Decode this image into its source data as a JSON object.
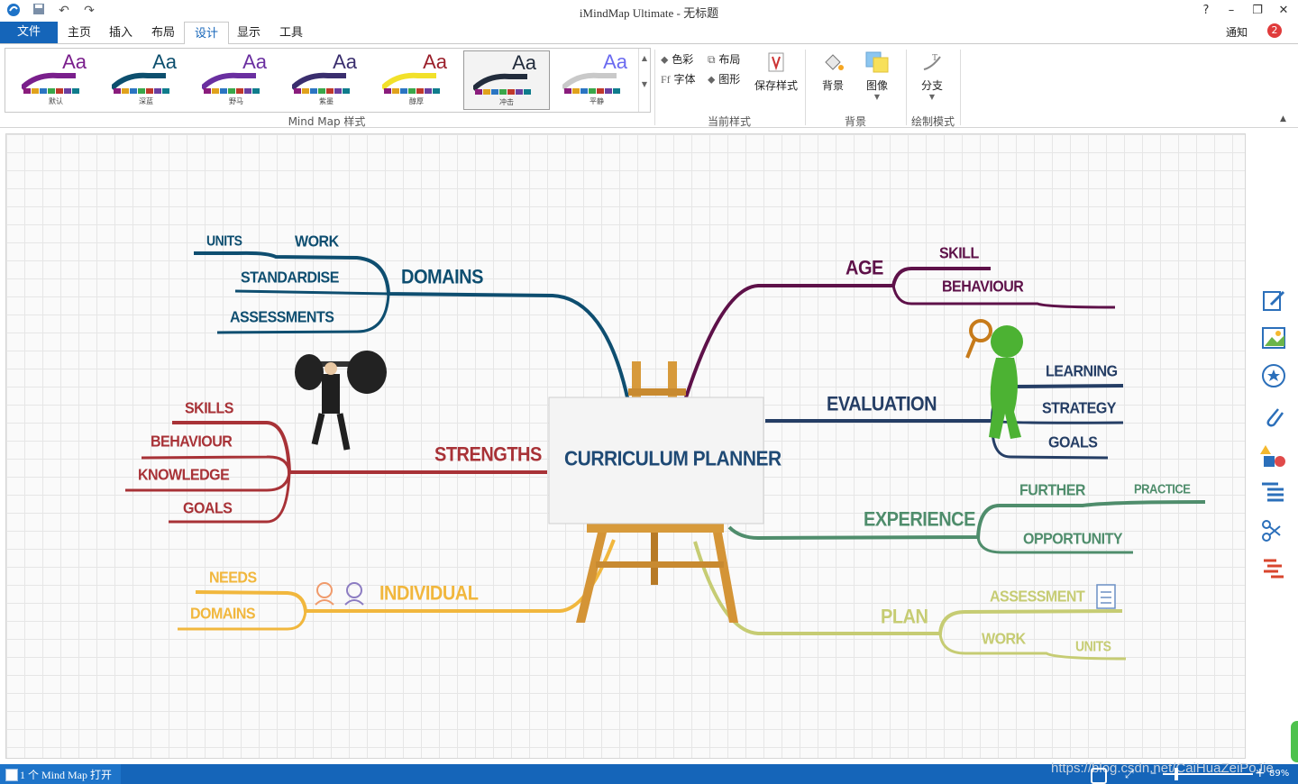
{
  "app": {
    "title": "iMindMap Ultimate - 无标题",
    "help": "?",
    "minimize": "–",
    "restore": "❐",
    "close": "✕"
  },
  "menu": {
    "file": "文件",
    "items": [
      "主页",
      "插入",
      "布局",
      "设计",
      "显示",
      "工具"
    ],
    "active": "设计",
    "notify_label": "通知",
    "notify_count": "2"
  },
  "ribbon": {
    "styles": [
      {
        "label": "默认",
        "color": "#7a1f8c"
      },
      {
        "label": "深蓝",
        "color": "#0d4f6e"
      },
      {
        "label": "野马",
        "color": "#6a2fa0"
      },
      {
        "label": "紫墨",
        "color": "#3a2e6e"
      },
      {
        "label": "醇厚",
        "color": "#f2e12a"
      },
      {
        "label": "冲击",
        "color": "#222c3c"
      },
      {
        "label": "平静",
        "color": "#c9c9c9"
      }
    ],
    "gallery_group": "Mind Map 样式",
    "color_label": "色彩",
    "layout_label": "布局",
    "font_label": "字体",
    "shape_label": "图形",
    "save_style_label": "保存样式",
    "current_group": "当前样式",
    "background_label": "背景",
    "image_label": "图像",
    "background_group": "背景",
    "branch_label": "分支",
    "draw_group": "绘制模式"
  },
  "mindmap": {
    "central": "CURRICULUM PLANNER",
    "branches": {
      "domains": {
        "label": "DOMAINS",
        "color": "#0e4e70",
        "children": [
          "UNITS",
          "WORK",
          "STANDARDISE",
          "ASSESSMENTS"
        ]
      },
      "age": {
        "label": "AGE",
        "color": "#5e1149",
        "children": [
          "SKILL",
          "BEHAVIOUR"
        ]
      },
      "evaluation": {
        "label": "EVALUATION",
        "color": "#253e65",
        "children": [
          "LEARNING",
          "STRATEGY",
          "GOALS"
        ]
      },
      "experience": {
        "label": "EXPERIENCE",
        "color": "#4f8d6c",
        "children": [
          "FURTHER",
          "PRACTICE",
          "OPPORTUNITY"
        ]
      },
      "plan": {
        "label": "PLAN",
        "color": "#c6cc73",
        "children": [
          "ASSESSMENT",
          "WORK",
          "UNITS"
        ]
      },
      "individual": {
        "label": "INDIVIDUAL",
        "color": "#f1b73d",
        "children": [
          "NEEDS",
          "DOMAINS"
        ]
      },
      "strengths": {
        "label": "STRENGTHS",
        "color": "#a83237",
        "children": [
          "SKILLS",
          "BEHAVIOUR",
          "KNOWLEDGE",
          "GOALS"
        ]
      }
    }
  },
  "status": {
    "open_count": "1 个 Mind Map 打开",
    "watermark": "https://blog.csdn.net/CaiHuaZeiPoJie",
    "zoom": "89%"
  }
}
